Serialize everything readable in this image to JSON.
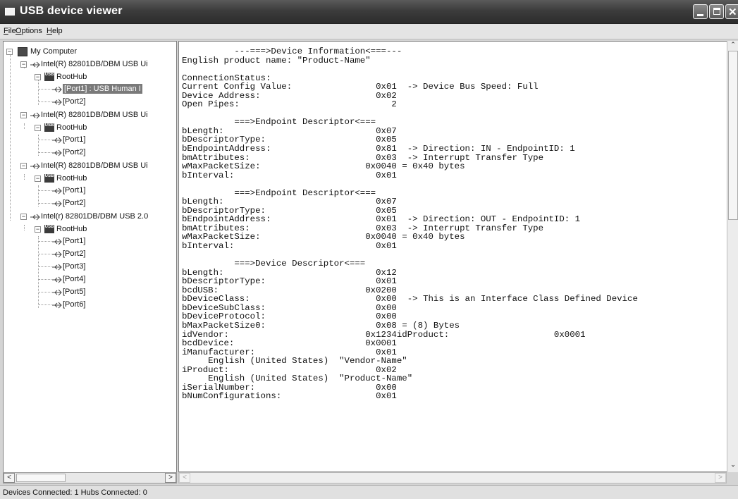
{
  "window": {
    "title": "USB device viewer"
  },
  "menu": {
    "file": {
      "mnemonic": "F",
      "rest": "ile"
    },
    "options": {
      "mnemonic": "O",
      "rest": "ptions"
    },
    "help": {
      "mnemonic": "H",
      "rest": "elp"
    }
  },
  "tree": {
    "root": "My Computer",
    "controllers": [
      {
        "label": "Intel(R) 82801DB/DBM USB Ui",
        "hub": "RootHub",
        "ports": [
          "[Port1]  :  USB Human I",
          "[Port2]"
        ]
      },
      {
        "label": "Intel(R) 82801DB/DBM USB Ui",
        "hub": "RootHub",
        "ports": [
          "[Port1]",
          "[Port2]"
        ]
      },
      {
        "label": "Intel(R) 82801DB/DBM USB Ui",
        "hub": "RootHub",
        "ports": [
          "[Port1]",
          "[Port2]"
        ]
      },
      {
        "label": "Intel(r) 82801DB/DBM USB 2.0",
        "hub": "RootHub",
        "ports": [
          "[Port1]",
          "[Port2]",
          "[Port3]",
          "[Port4]",
          "[Port5]",
          "[Port6]"
        ]
      }
    ]
  },
  "details": {
    "lines": [
      "          ---===>Device Information<===---",
      "English product name: \"Product-Name\"",
      "",
      "ConnectionStatus:",
      "Current Config Value:                0x01  -> Device Bus Speed: Full",
      "Device Address:                      0x02",
      "Open Pipes:                             2",
      "",
      "          ===>Endpoint Descriptor<===",
      "bLength:                             0x07",
      "bDescriptorType:                     0x05",
      "bEndpointAddress:                    0x81  -> Direction: IN - EndpointID: 1",
      "bmAttributes:                        0x03  -> Interrupt Transfer Type",
      "wMaxPacketSize:                    0x0040 = 0x40 bytes",
      "bInterval:                           0x01",
      "",
      "          ===>Endpoint Descriptor<===",
      "bLength:                             0x07",
      "bDescriptorType:                     0x05",
      "bEndpointAddress:                    0x01  -> Direction: OUT - EndpointID: 1",
      "bmAttributes:                        0x03  -> Interrupt Transfer Type",
      "wMaxPacketSize:                    0x0040 = 0x40 bytes",
      "bInterval:                           0x01",
      "",
      "          ===>Device Descriptor<===",
      "bLength:                             0x12",
      "bDescriptorType:                     0x01",
      "bcdUSB:                            0x0200",
      "bDeviceClass:                        0x00  -> This is an Interface Class Defined Device",
      "bDeviceSubClass:                     0x00",
      "bDeviceProtocol:                     0x00",
      "bMaxPacketSize0:                     0x08 = (8) Bytes",
      "idVendor:                          0x1234idProduct:                    0x0001",
      "bcdDevice:                         0x0001",
      "iManufacturer:                       0x01",
      "     English (United States)  \"Vendor-Name\"",
      "iProduct:                            0x02",
      "     English (United States)  \"Product-Name\"",
      "iSerialNumber:                       0x00",
      "bNumConfigurations:                  0x01"
    ]
  },
  "status": {
    "text": "Devices Connected: 1   Hubs Connected: 0"
  }
}
